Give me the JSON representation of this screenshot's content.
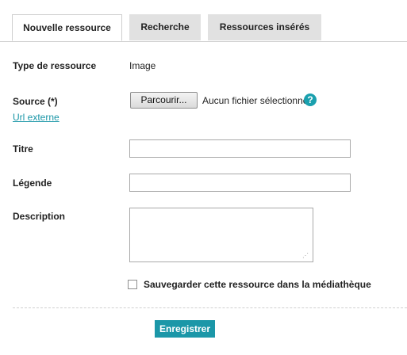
{
  "tabs": [
    {
      "label": "Nouvelle ressource",
      "active": true
    },
    {
      "label": "Recherche",
      "active": false
    },
    {
      "label": "Ressources insérés",
      "active": false
    }
  ],
  "form": {
    "type_label": "Type de ressource",
    "type_value": "Image",
    "source_label": "Source (*)",
    "browse_button": "Parcourir...",
    "no_file_text": "Aucun fichier sélectionné.",
    "help_icon_glyph": "?",
    "external_url_link": "Url externe",
    "title_label": "Titre",
    "title_value": "",
    "caption_label": "Légende",
    "caption_value": "",
    "description_label": "Description",
    "description_value": "",
    "save_to_library_label": "Sauvegarder cette ressource dans la médiathèque",
    "save_to_library_checked": false,
    "submit_button": "Enregistrer"
  },
  "colors": {
    "accent": "#1b97a8",
    "link": "#1a96a7",
    "inactive_tab": "#e1e1e1"
  }
}
